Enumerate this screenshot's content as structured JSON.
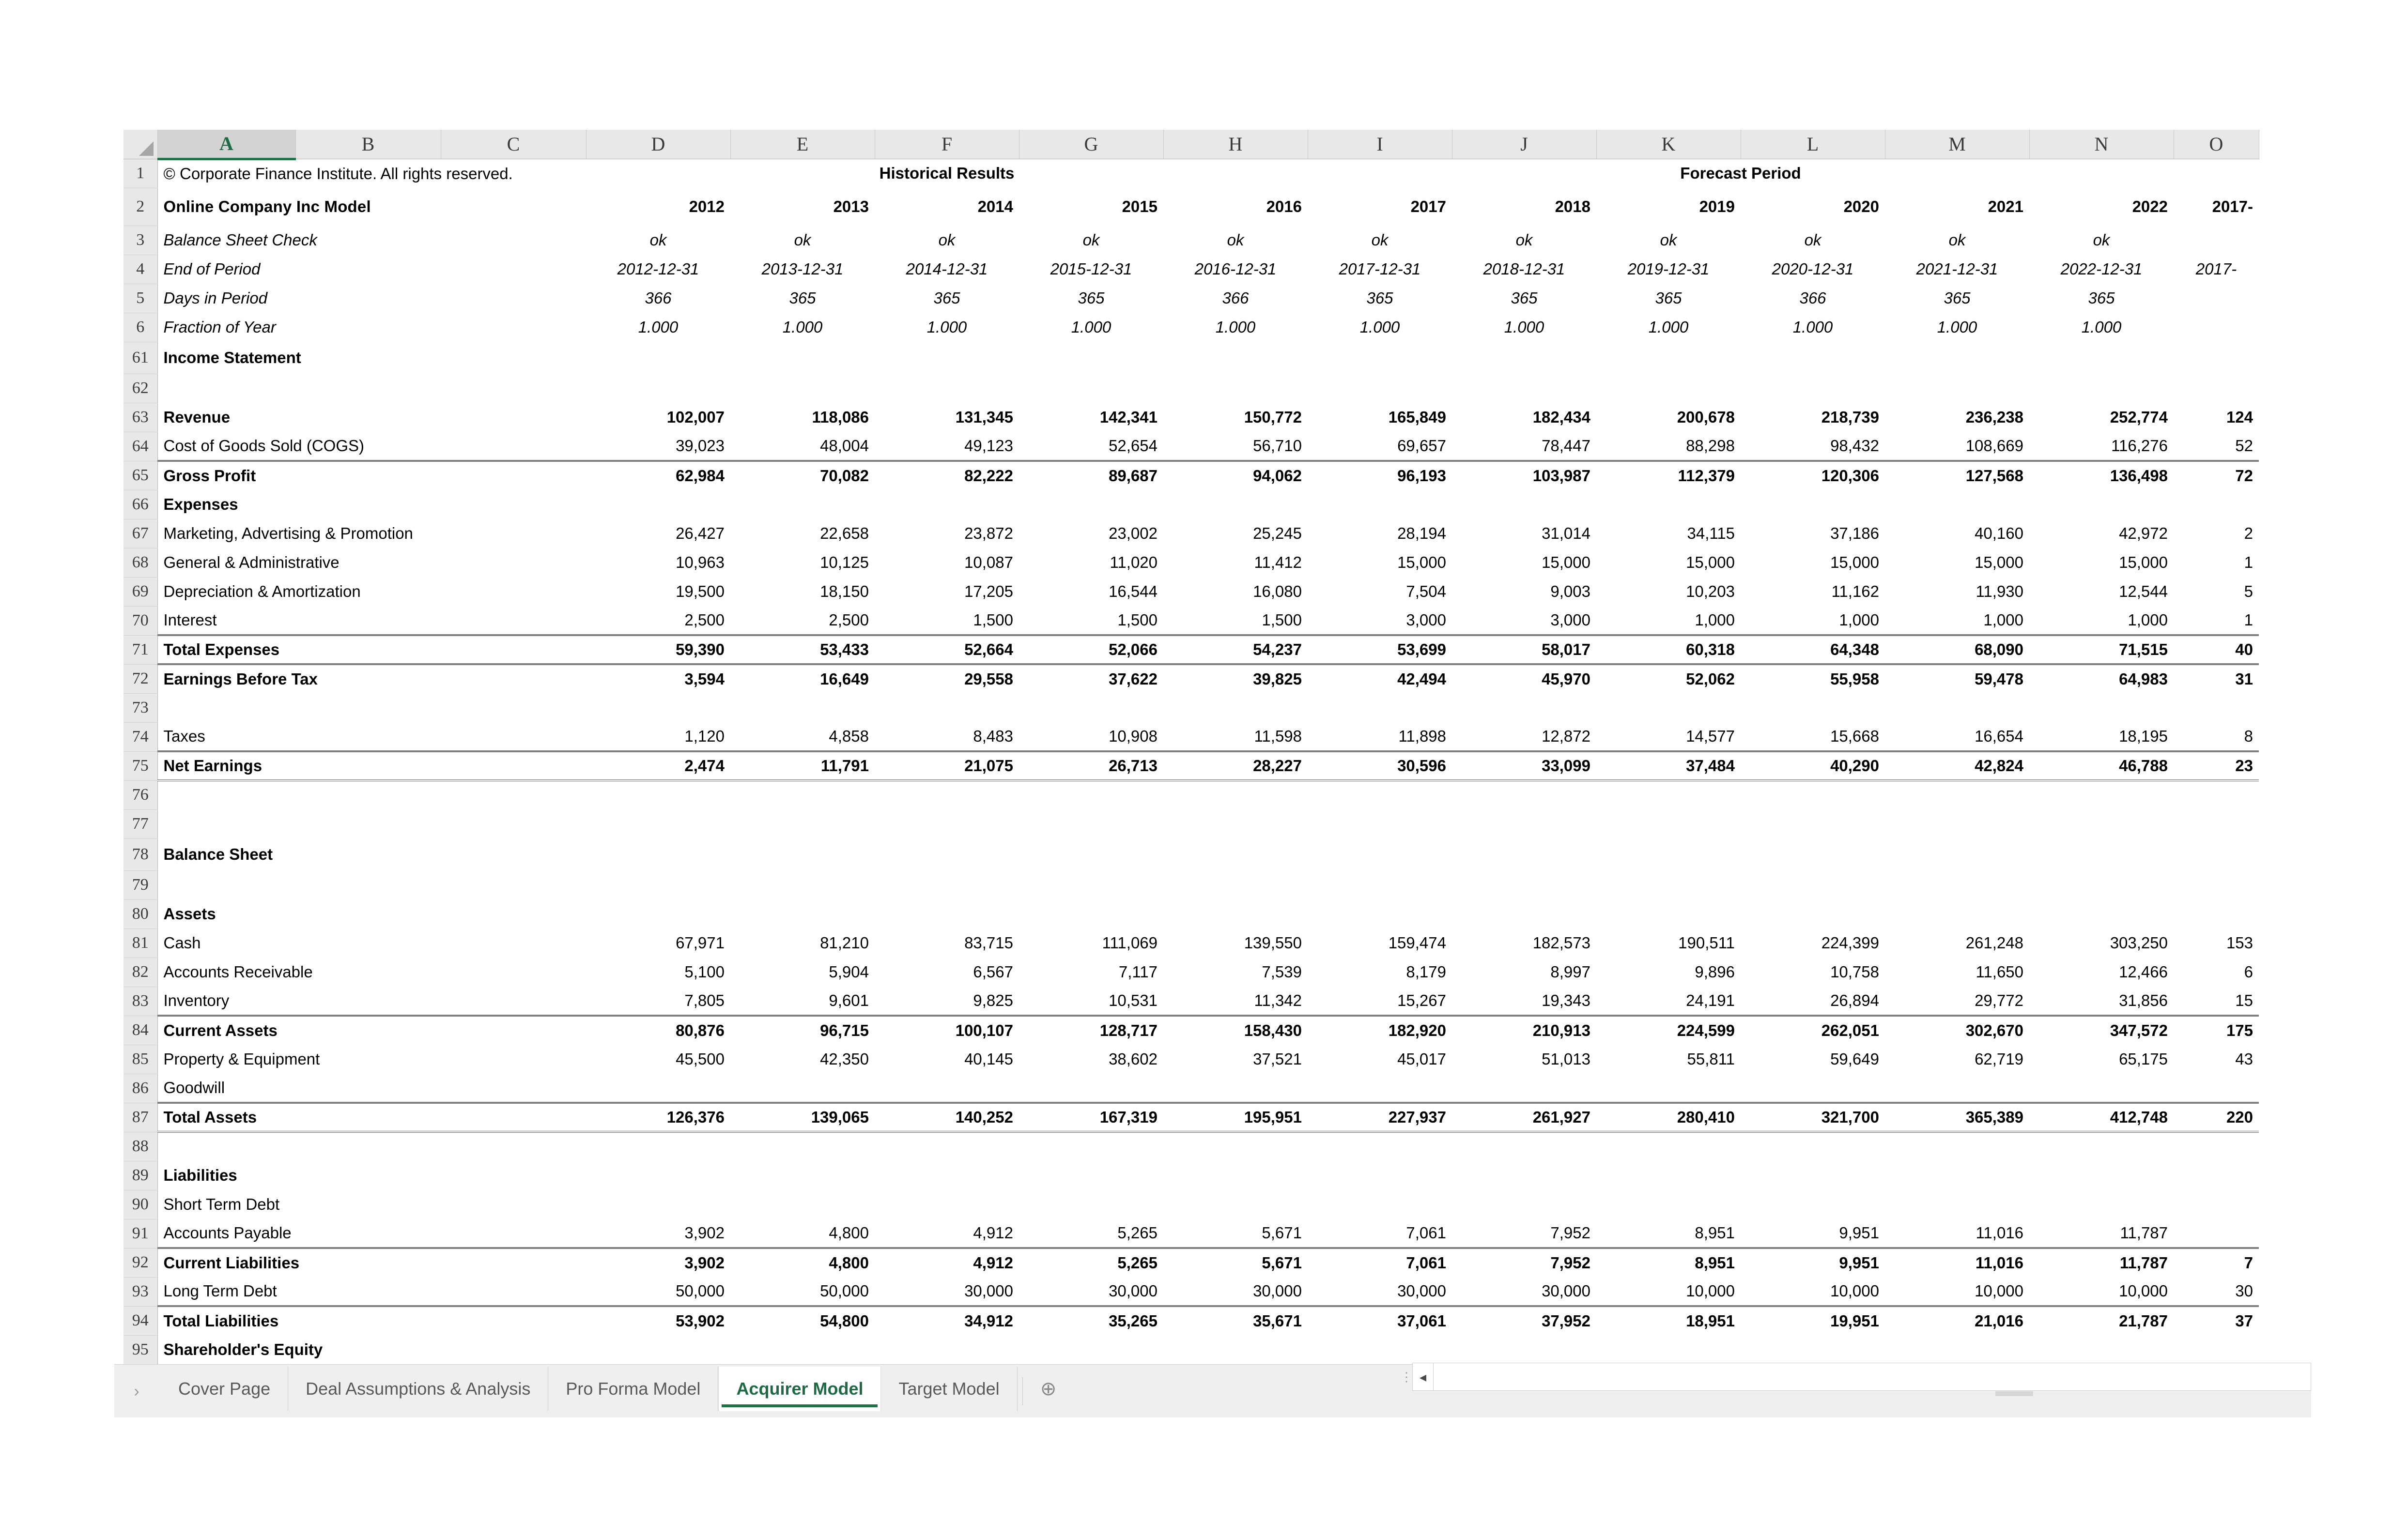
{
  "workbook": {
    "copyright": "© Corporate Finance Institute. All rights reserved.",
    "model_title": "Online Company Inc Model"
  },
  "column_headers": [
    "A",
    "B",
    "C",
    "D",
    "E",
    "F",
    "G",
    "H",
    "I",
    "J",
    "K",
    "L",
    "M",
    "N",
    "O"
  ],
  "selected_column": "A",
  "group_headers": {
    "historical": "Historical Results",
    "forecast": "Forecast Period"
  },
  "years": {
    "historical": [
      "2012",
      "2013",
      "2014",
      "2015",
      "2016"
    ],
    "forecast": [
      "2017",
      "2018",
      "2019",
      "2020",
      "2021",
      "2022"
    ],
    "cutoff": "2017-"
  },
  "header_rows": [
    {
      "row": "3",
      "label": "Balance Sheet Check",
      "values": [
        "ok",
        "ok",
        "ok",
        "ok",
        "ok",
        "ok",
        "ok",
        "ok",
        "ok",
        "ok",
        "ok"
      ],
      "cutoff": ""
    },
    {
      "row": "4",
      "label": "End of Period",
      "values": [
        "2012-12-31",
        "2013-12-31",
        "2014-12-31",
        "2015-12-31",
        "2016-12-31",
        "2017-12-31",
        "2018-12-31",
        "2019-12-31",
        "2020-12-31",
        "2021-12-31",
        "2022-12-31"
      ],
      "cutoff": "2017-"
    },
    {
      "row": "5",
      "label": "Days in Period",
      "values": [
        "366",
        "365",
        "365",
        "365",
        "366",
        "365",
        "365",
        "365",
        "366",
        "365",
        "365"
      ],
      "cutoff": ""
    },
    {
      "row": "6",
      "label": "Fraction of Year",
      "values": [
        "1.000",
        "1.000",
        "1.000",
        "1.000",
        "1.000",
        "1.000",
        "1.000",
        "1.000",
        "1.000",
        "1.000",
        "1.000"
      ],
      "cutoff": ""
    }
  ],
  "sections": [
    {
      "row": "61",
      "title": "Income Statement"
    },
    {
      "row": "78",
      "title": "Balance Sheet"
    }
  ],
  "income_statement": [
    {
      "row": "63",
      "label": "Revenue",
      "style": "bold",
      "values": [
        "102,007",
        "118,086",
        "131,345",
        "142,341",
        "150,772",
        "165,849",
        "182,434",
        "200,678",
        "218,739",
        "236,238",
        "252,774"
      ],
      "cutoff": "124"
    },
    {
      "row": "64",
      "label": "Cost of Goods Sold (COGS)",
      "style": "plain",
      "values": [
        "39,023",
        "48,004",
        "49,123",
        "52,654",
        "56,710",
        "69,657",
        "78,447",
        "88,298",
        "98,432",
        "108,669",
        "116,276"
      ],
      "cutoff": "52"
    },
    {
      "row": "65",
      "label": "Gross Profit",
      "style": "bold",
      "rule": "top",
      "values": [
        "62,984",
        "70,082",
        "82,222",
        "89,687",
        "94,062",
        "96,193",
        "103,987",
        "112,379",
        "120,306",
        "127,568",
        "136,498"
      ],
      "cutoff": "72"
    },
    {
      "row": "66",
      "label": "Expenses",
      "style": "bold",
      "values": [
        "",
        "",
        "",
        "",
        "",
        "",
        "",
        "",
        "",
        "",
        ""
      ],
      "cutoff": ""
    },
    {
      "row": "67",
      "label": "Marketing, Advertising & Promotion",
      "style": "plain",
      "values": [
        "26,427",
        "22,658",
        "23,872",
        "23,002",
        "25,245",
        "28,194",
        "31,014",
        "34,115",
        "37,186",
        "40,160",
        "42,972"
      ],
      "cutoff": "2"
    },
    {
      "row": "68",
      "label": "General & Administrative",
      "style": "plain",
      "values": [
        "10,963",
        "10,125",
        "10,087",
        "11,020",
        "11,412",
        "15,000",
        "15,000",
        "15,000",
        "15,000",
        "15,000",
        "15,000"
      ],
      "cutoff": "1"
    },
    {
      "row": "69",
      "label": "Depreciation & Amortization",
      "style": "plain",
      "values": [
        "19,500",
        "18,150",
        "17,205",
        "16,544",
        "16,080",
        "7,504",
        "9,003",
        "10,203",
        "11,162",
        "11,930",
        "12,544"
      ],
      "cutoff": "5"
    },
    {
      "row": "70",
      "label": "Interest",
      "style": "plain",
      "values": [
        "2,500",
        "2,500",
        "1,500",
        "1,500",
        "1,500",
        "3,000",
        "3,000",
        "1,000",
        "1,000",
        "1,000",
        "1,000"
      ],
      "cutoff": "1"
    },
    {
      "row": "71",
      "label": "Total Expenses",
      "style": "bold",
      "rule": "top",
      "values": [
        "59,390",
        "53,433",
        "52,664",
        "52,066",
        "54,237",
        "53,699",
        "58,017",
        "60,318",
        "64,348",
        "68,090",
        "71,515"
      ],
      "cutoff": "40"
    },
    {
      "row": "72",
      "label": "Earnings Before Tax",
      "style": "bold",
      "rule": "top",
      "values": [
        "3,594",
        "16,649",
        "29,558",
        "37,622",
        "39,825",
        "42,494",
        "45,970",
        "52,062",
        "55,958",
        "59,478",
        "64,983"
      ],
      "cutoff": "31"
    },
    {
      "row": "73",
      "label": "",
      "style": "plain",
      "values": [
        "",
        "",
        "",
        "",
        "",
        "",
        "",
        "",
        "",
        "",
        ""
      ],
      "cutoff": ""
    },
    {
      "row": "74",
      "label": "Taxes",
      "style": "plain",
      "values": [
        "1,120",
        "4,858",
        "8,483",
        "10,908",
        "11,598",
        "11,898",
        "12,872",
        "14,577",
        "15,668",
        "16,654",
        "18,195"
      ],
      "cutoff": "8"
    },
    {
      "row": "75",
      "label": "Net Earnings",
      "style": "bold",
      "rule": "top",
      "rule_bottom": "double",
      "values": [
        "2,474",
        "11,791",
        "21,075",
        "26,713",
        "28,227",
        "30,596",
        "33,099",
        "37,484",
        "40,290",
        "42,824",
        "46,788"
      ],
      "cutoff": "23"
    },
    {
      "row": "76",
      "label": "",
      "style": "plain",
      "values": [
        "",
        "",
        "",
        "",
        "",
        "",
        "",
        "",
        "",
        "",
        ""
      ],
      "cutoff": ""
    },
    {
      "row": "77",
      "label": "",
      "style": "plain",
      "values": [
        "",
        "",
        "",
        "",
        "",
        "",
        "",
        "",
        "",
        "",
        ""
      ],
      "cutoff": ""
    }
  ],
  "balance_sheet": [
    {
      "row": "79",
      "label": "",
      "style": "plain",
      "values": [
        "",
        "",
        "",
        "",
        "",
        "",
        "",
        "",
        "",
        "",
        ""
      ],
      "cutoff": ""
    },
    {
      "row": "80",
      "label": "Assets",
      "style": "bold",
      "values": [
        "",
        "",
        "",
        "",
        "",
        "",
        "",
        "",
        "",
        "",
        ""
      ],
      "cutoff": ""
    },
    {
      "row": "81",
      "label": "Cash",
      "style": "plain",
      "color": "black",
      "values": [
        "67,971",
        "81,210",
        "83,715",
        "111,069",
        "139,550",
        "159,474",
        "182,573",
        "190,511",
        "224,399",
        "261,248",
        "303,250"
      ],
      "cutoff": "153"
    },
    {
      "row": "82",
      "label": "Accounts Receivable",
      "style": "plain",
      "values": [
        "5,100",
        "5,904",
        "6,567",
        "7,117",
        "7,539",
        "8,179",
        "8,997",
        "9,896",
        "10,758",
        "11,650",
        "12,466"
      ],
      "cutoff": "6"
    },
    {
      "row": "83",
      "label": "Inventory",
      "style": "plain",
      "values": [
        "7,805",
        "9,601",
        "9,825",
        "10,531",
        "11,342",
        "15,267",
        "19,343",
        "24,191",
        "26,894",
        "29,772",
        "31,856"
      ],
      "cutoff": "15"
    },
    {
      "row": "84",
      "label": "Current Assets",
      "style": "bold",
      "rule": "top",
      "values": [
        "80,876",
        "96,715",
        "100,107",
        "128,717",
        "158,430",
        "182,920",
        "210,913",
        "224,599",
        "262,051",
        "302,670",
        "347,572"
      ],
      "cutoff": "175"
    },
    {
      "row": "85",
      "label": "Property & Equipment",
      "style": "plain",
      "values": [
        "45,500",
        "42,350",
        "40,145",
        "38,602",
        "37,521",
        "45,017",
        "51,013",
        "55,811",
        "59,649",
        "62,719",
        "65,175"
      ],
      "cutoff": "43"
    },
    {
      "row": "86",
      "label": "Goodwill",
      "style": "plain",
      "values": [
        "",
        "",
        "",
        "",
        "",
        "",
        "",
        "",
        "",
        "",
        ""
      ],
      "cutoff": ""
    },
    {
      "row": "87",
      "label": "Total Assets",
      "style": "bold",
      "rule": "top",
      "rule_bottom": "double",
      "values": [
        "126,376",
        "139,065",
        "140,252",
        "167,319",
        "195,951",
        "227,937",
        "261,927",
        "280,410",
        "321,700",
        "365,389",
        "412,748"
      ],
      "cutoff": "220"
    },
    {
      "row": "88",
      "label": "",
      "style": "plain",
      "values": [
        "",
        "",
        "",
        "",
        "",
        "",
        "",
        "",
        "",
        "",
        ""
      ],
      "cutoff": ""
    },
    {
      "row": "89",
      "label": "Liabilities",
      "style": "bold",
      "values": [
        "",
        "",
        "",
        "",
        "",
        "",
        "",
        "",
        "",
        "",
        ""
      ],
      "cutoff": ""
    },
    {
      "row": "90",
      "label": "Short Term Debt",
      "style": "plain",
      "values": [
        "",
        "",
        "",
        "",
        "",
        "",
        "",
        "",
        "",
        "",
        ""
      ],
      "cutoff": ""
    },
    {
      "row": "91",
      "label": "Accounts Payable",
      "style": "plain",
      "values": [
        "3,902",
        "4,800",
        "4,912",
        "5,265",
        "5,671",
        "7,061",
        "7,952",
        "8,951",
        "9,951",
        "11,016",
        "11,787"
      ],
      "cutoff": ""
    },
    {
      "row": "92",
      "label": "Current Liabilities",
      "style": "bold",
      "rule": "top",
      "values": [
        "3,902",
        "4,800",
        "4,912",
        "5,265",
        "5,671",
        "7,061",
        "7,952",
        "8,951",
        "9,951",
        "11,016",
        "11,787"
      ],
      "cutoff": "7"
    },
    {
      "row": "93",
      "label": "Long Term Debt",
      "style": "plain",
      "values": [
        "50,000",
        "50,000",
        "30,000",
        "30,000",
        "30,000",
        "30,000",
        "30,000",
        "10,000",
        "10,000",
        "10,000",
        "10,000"
      ],
      "cutoff": "30"
    },
    {
      "row": "94",
      "label": "Total Liabilities",
      "style": "bold",
      "rule": "top",
      "values": [
        "53,902",
        "54,800",
        "34,912",
        "35,265",
        "35,671",
        "37,061",
        "37,952",
        "18,951",
        "19,951",
        "21,016",
        "21,787"
      ],
      "cutoff": "37"
    },
    {
      "row": "95",
      "label": "Shareholder's Equity",
      "style": "bold",
      "values": [
        "",
        "",
        "",
        "",
        "",
        "",
        "",
        "",
        "",
        "",
        ""
      ],
      "cutoff": ""
    }
  ],
  "blue_input_columns": 5,
  "tabs": {
    "prev_icon": "›",
    "items": [
      {
        "label": "Cover Page",
        "active": false
      },
      {
        "label": "Deal Assumptions & Analysis",
        "active": false
      },
      {
        "label": "Pro Forma Model",
        "active": false
      },
      {
        "label": "Acquirer Model",
        "active": true
      },
      {
        "label": "Target Model",
        "active": false
      }
    ],
    "add_label": "⊕"
  },
  "scrollbar": {
    "left_arrow": "◂"
  },
  "colors": {
    "navy": "#1f3864",
    "teal": "#1a8193",
    "orange": "#ef9324",
    "gray_header": "#8c8c8c",
    "input_blue": "#1414e6",
    "excel_green": "#217346"
  }
}
